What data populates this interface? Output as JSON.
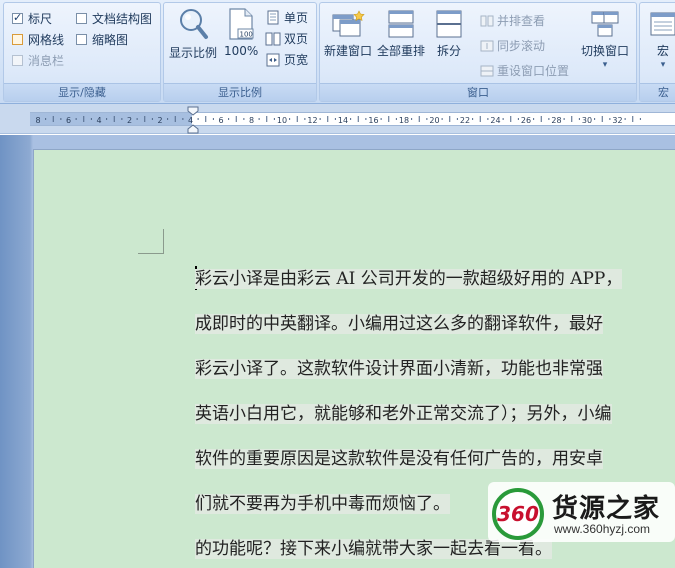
{
  "ribbon": {
    "show_hide": {
      "label": "显示/隐藏",
      "ruler": "标尺",
      "doc_map": "文档结构图",
      "gridlines": "网格线",
      "thumbnails": "缩略图",
      "message_bar": "消息栏"
    },
    "zoom": {
      "label": "显示比例",
      "zoom_btn": "显示比例",
      "hundred_btn": "100%",
      "one_page": "单页",
      "two_pages": "双页",
      "page_width": "页宽"
    },
    "window": {
      "label": "窗口",
      "new_window": "新建窗口",
      "arrange_all": "全部重排",
      "split": "拆分",
      "side_by_side": "并排查看",
      "sync_scroll": "同步滚动",
      "reset_position": "重设窗口位置",
      "switch_windows": "切换窗口"
    },
    "macros": {
      "label": "宏",
      "macros_btn": "宏"
    }
  },
  "ruler": {
    "labels": [
      "8",
      "6",
      "4",
      "2",
      "2",
      "4",
      "6",
      "8",
      "10",
      "12",
      "14",
      "16",
      "18",
      "20",
      "22",
      "24",
      "26",
      "28",
      "30",
      "32"
    ]
  },
  "document": {
    "lines": [
      "彩云小译是由彩云 AI 公司开发的一款超级好用的 APP，",
      "成即时的中英翻译。小编用过这么多的翻译软件，最好",
      "彩云小译了。这款软件设计界面小清新，功能也非常强",
      "英语小白用它，就能够和老外正常交流了）；另外，小编",
      "软件的重要原因是这款软件是没有任何广告的，用安卓",
      "们就不要再为手机中毒而烦恼了。",
      "的功能呢？接下来小编就带大家一起去看一看。"
    ]
  },
  "watermark": {
    "logo_text": "360",
    "brand": "货源之家",
    "url": "www.360hyzj.com"
  },
  "colors": {
    "page_bg": "#cce8cf",
    "ribbon_bg": "#dde9f9",
    "workspace": "#a9c0e2"
  }
}
